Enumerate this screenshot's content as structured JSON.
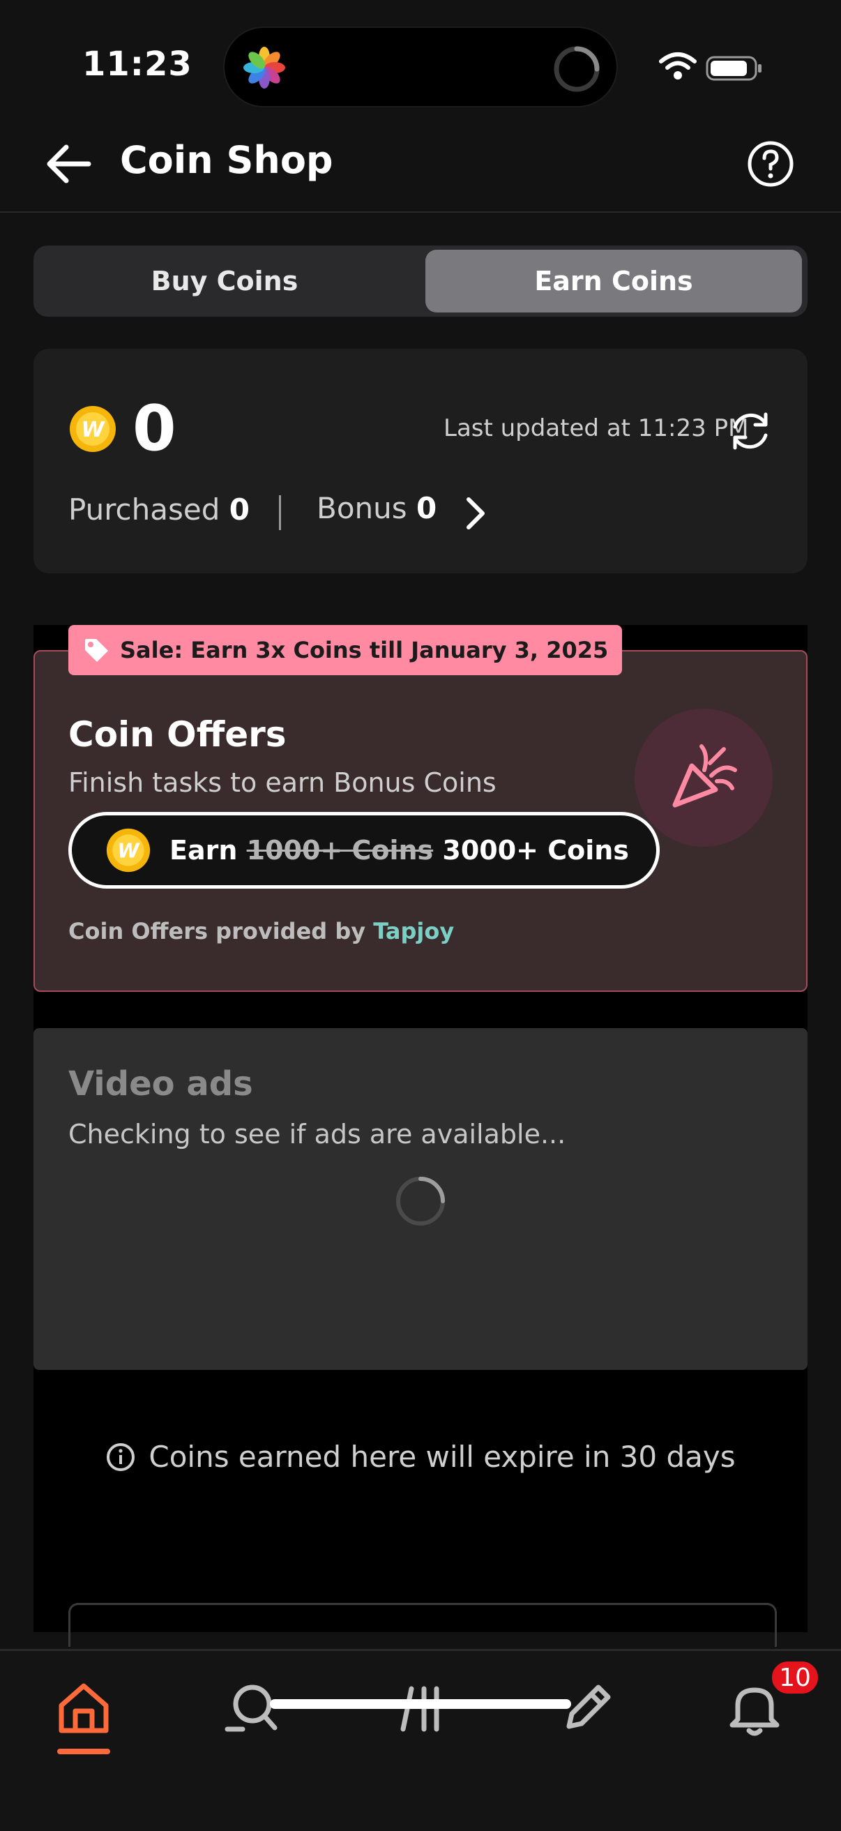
{
  "status_bar": {
    "time": "11:23"
  },
  "header": {
    "title": "Coin Shop"
  },
  "segment": {
    "buy_label": "Buy Coins",
    "earn_label": "Earn Coins",
    "selected": "Earn Coins"
  },
  "balance": {
    "amount": "0",
    "last_updated": "Last updated at 11:23 PM",
    "purchased_label": "Purchased",
    "purchased_value": "0",
    "bonus_label": "Bonus",
    "bonus_value": "0"
  },
  "coin_offers": {
    "sale_badge": "Sale: Earn 3x Coins till January 3, 2025",
    "title": "Coin Offers",
    "subtitle": "Finish tasks to earn Bonus Coins",
    "earn_prefix": "Earn",
    "earn_old": "1000+ Coins",
    "earn_new": "3000+ Coins",
    "provided_by": "Coin Offers provided by",
    "provider": "Tapjoy"
  },
  "video_ads": {
    "title": "Video ads",
    "status": "Checking to see if ads are available..."
  },
  "expiry_note": "Coins earned here will expire in 30 days",
  "tabbar": {
    "items": [
      "home",
      "search",
      "library",
      "write",
      "notifications"
    ],
    "active": "home",
    "notification_count": "10"
  },
  "colors": {
    "accent": "#ff6a3a",
    "sale_badge": "#ff8aa2",
    "offers_bg": "#3a2b2d",
    "tapjoy": "#7ccfc5",
    "badge": "#e5131c",
    "coin": "#f5b50a"
  },
  "icons": [
    "back-arrow-icon",
    "help-icon",
    "coin-icon",
    "refresh-icon",
    "chevron-right-icon",
    "tag-icon",
    "party-popper-icon",
    "info-icon",
    "home-icon",
    "search-icon",
    "library-icon",
    "pencil-icon",
    "bell-icon"
  ]
}
